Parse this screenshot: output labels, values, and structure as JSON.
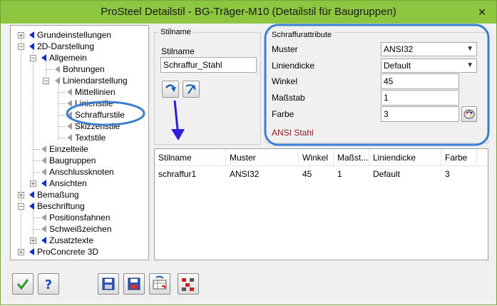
{
  "window": {
    "title": "ProSteel Detailstil - BG-Träger-M10 (Detailstil für Baugruppen)"
  },
  "tree": {
    "items": [
      {
        "label": "Grundeinstellungen"
      },
      {
        "label": "2D-Darstellung"
      },
      {
        "label": "Allgemein"
      },
      {
        "label": "Bohrungen"
      },
      {
        "label": "Liniendarstellung"
      },
      {
        "label": "Mittellinien"
      },
      {
        "label": "Linienstile"
      },
      {
        "label": "Schraffurstile"
      },
      {
        "label": "Skizzenstile"
      },
      {
        "label": "Textstile"
      },
      {
        "label": "Einzelteile"
      },
      {
        "label": "Baugruppen"
      },
      {
        "label": "Anschlussknoten"
      },
      {
        "label": "Ansichten"
      },
      {
        "label": "Bemaßung"
      },
      {
        "label": "Beschriftung"
      },
      {
        "label": "Positionsfahnen"
      },
      {
        "label": "Schweißzeichen"
      },
      {
        "label": "Zusatztexte"
      },
      {
        "label": "ProConcrete 3D"
      }
    ]
  },
  "stilname": {
    "group_label": "Stilname",
    "field_label": "Stilname",
    "value": "Schraffur_Stahl"
  },
  "attribute": {
    "group_label": "Schraffurattribute",
    "muster_label": "Muster",
    "muster_value": "ANSI32",
    "liniendicke_label": "Liniendicke",
    "liniendicke_value": "Default",
    "winkel_label": "Winkel",
    "winkel_value": "45",
    "massstab_label": "Maßstab",
    "massstab_value": "1",
    "farbe_label": "Farbe",
    "farbe_value": "3",
    "preview_text": "ANSI Stahl"
  },
  "table": {
    "headers": [
      "Stilname",
      "Muster",
      "Winkel",
      "Maßst...",
      "Liniendicke",
      "Farbe"
    ],
    "rows": [
      [
        "schraffur1",
        "ANSI32",
        "45",
        "1",
        "Default",
        "3"
      ]
    ]
  },
  "colors": {
    "titlebar": "#8dc63f",
    "highlight": "#3b7fd1",
    "tree_arrow": "#0b2fd6",
    "preview_text": "#8b1a1a"
  }
}
